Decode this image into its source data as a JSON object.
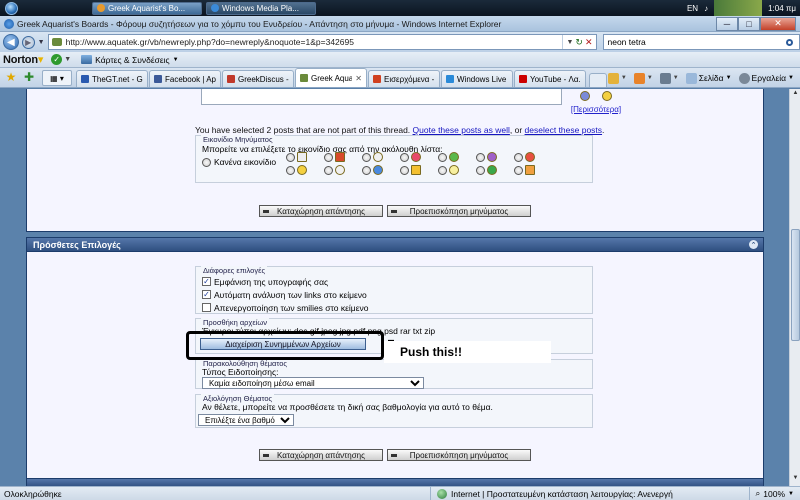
{
  "taskbar": {
    "buttons": [
      {
        "label": "Greek Aquarist's Bo...",
        "active": true
      },
      {
        "label": "Windows Media Pla..."
      }
    ],
    "language": "EN",
    "clock": "1:04 πμ"
  },
  "window": {
    "title": "Greek Aquarist's Boards - Φόρουμ συζητήσεων για το χόμπυ του Ενυδρείου - Απάντηση στο μήνυμα - Windows Internet Explorer",
    "minimize": "─",
    "maximize": "□",
    "close": "✕"
  },
  "address": {
    "url": "http://www.aquatek.gr/vb/newreply.php?do=newreply&noquote=1&p=342695",
    "search_value": "neon tetra"
  },
  "norton": {
    "logo": "Norton",
    "cards_label": "Κάρτες & Συνδέσεις"
  },
  "tabs": [
    {
      "label": "TheGT.net - Gr...",
      "color": "#2a5ab0"
    },
    {
      "label": "Facebook | Ap...",
      "color": "#3b5998"
    },
    {
      "label": "GreekDiscus - ...",
      "color": "#c0392b"
    },
    {
      "label": "Greek Aqua...",
      "color": "#6b8b3b",
      "active": true
    },
    {
      "label": "Εισερχόμενα - ...",
      "color": "#d04020"
    },
    {
      "label": "Windows Live ...",
      "color": "#2a8ad8"
    },
    {
      "label": "YouTube - Λα...",
      "color": "#cc0000"
    }
  ],
  "commands": {
    "page": "Σελίδα",
    "tools": "Εργαλεία"
  },
  "reply_form": {
    "more_smilies": "[Περισσότερα]",
    "selected_posts_prefix": "You have selected 2 posts that are not part of this thread.",
    "quote_link": "Quote these posts as well",
    "or_text": ", or",
    "deselect_link": "deselect these posts",
    "period": ".",
    "icons_legend": "Εικονίδιο Μηνύματος",
    "icons_instruction": "Μπορείτε να επιλέξετε το εικονίδιο σας από την ακόλουθη λίστα:",
    "no_icon_label": "Κανένα εικονίδιο",
    "submit_button": "Καταχώρηση απάντησης",
    "preview_button": "Προεπισκόπηση μηνύματος"
  },
  "options_panel": {
    "title": "Πρόσθετες Επιλογές",
    "misc_legend": "Διάφορες επιλογές",
    "misc_options": [
      {
        "label": "Εμφάνιση της υπογραφής σας",
        "checked": true
      },
      {
        "label": "Αυτόματη ανάλυση των links στο κείμενο",
        "checked": true
      },
      {
        "label": "Απενεργοποίηση των smilies στο κείμενο",
        "checked": false
      }
    ],
    "attach_legend": "Προσθήκη αρχείων",
    "attach_types": "Έγκυροι τύποι αρχείων: doc gif jpeg jpg pdf png psd rar txt zip",
    "attach_button": "Διαχείριση Συνημμένων Αρχείων",
    "subscribe_legend": "Παρακολούθηση θέματος",
    "subscribe_label": "Τύπος Ειδοποίησης:",
    "subscribe_selected": "Καμία ειδοποίηση μέσω email",
    "rating_legend": "Αξιολόγηση Θέματος",
    "rating_label": "Αν θέλετε, μπορείτε να προσθέσετε τη δική σας βαθμολογία για αυτό το θέμα.",
    "rating_selected": "Επιλέξτε ένα βαθμό",
    "submit_button": "Καταχώρηση απάντησης",
    "preview_button": "Προεπισκόπηση μηνύματος"
  },
  "annotation": {
    "callout_text": "Push this!!"
  },
  "status": {
    "left": "Ολοκληρώθηκε",
    "zone": "Internet | Προστατευμένη κατάσταση λειτουργίας: Ανενεργή",
    "zoom": "100%"
  }
}
